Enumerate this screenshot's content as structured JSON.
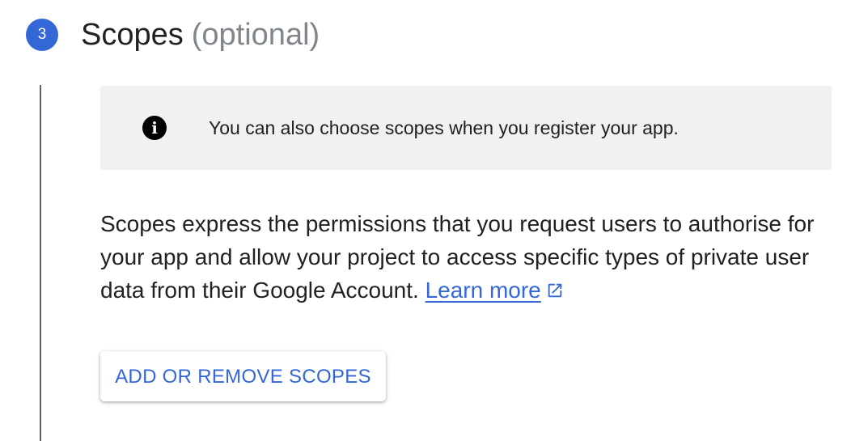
{
  "step": {
    "number": "3",
    "title": "Scopes",
    "optional_label": "(optional)"
  },
  "info_banner": {
    "icon": "info-icon",
    "text": "You can also choose scopes when you register your app."
  },
  "description": {
    "text": "Scopes express the permissions that you request users to authorise for your app and allow your project to access specific types of private user data from their Google Account.",
    "link_label": "Learn more",
    "link_icon": "external-link-icon"
  },
  "actions": {
    "add_remove_scopes_label": "ADD OR REMOVE SCOPES"
  },
  "colors": {
    "accent": "#3367d6",
    "banner_bg": "#f1f1f1",
    "muted_text": "#80868b"
  }
}
